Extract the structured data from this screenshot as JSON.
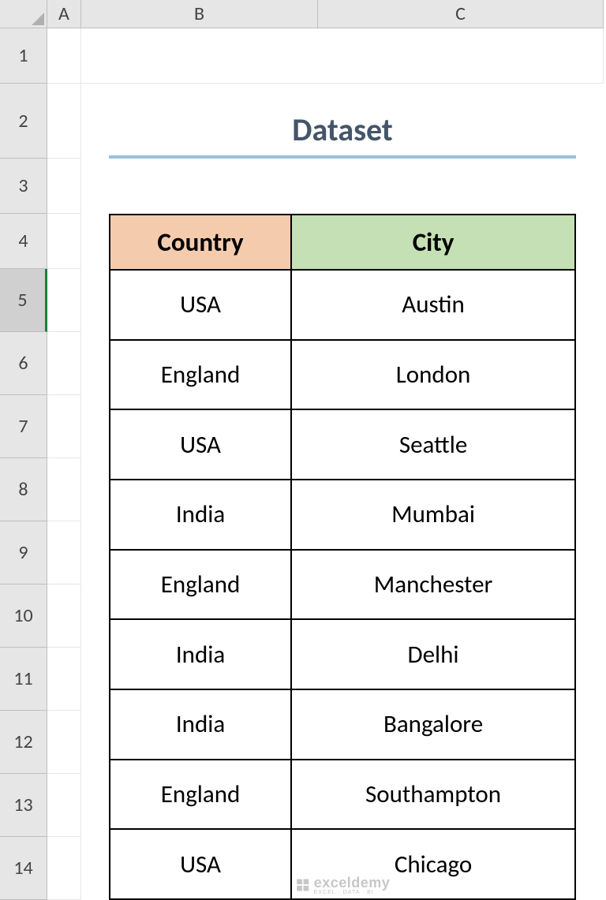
{
  "columns": [
    "A",
    "B",
    "C"
  ],
  "rows": [
    "1",
    "2",
    "3",
    "4",
    "5",
    "6",
    "7",
    "8",
    "9",
    "10",
    "11",
    "12",
    "13",
    "14"
  ],
  "selected_row": "5",
  "title": "Dataset",
  "table": {
    "headers": {
      "country": "Country",
      "city": "City"
    },
    "rows": [
      {
        "country": "USA",
        "city": "Austin"
      },
      {
        "country": "England",
        "city": "London"
      },
      {
        "country": "USA",
        "city": "Seattle"
      },
      {
        "country": "India",
        "city": "Mumbai"
      },
      {
        "country": "England",
        "city": "Manchester"
      },
      {
        "country": "India",
        "city": "Delhi"
      },
      {
        "country": "India",
        "city": "Bangalore"
      },
      {
        "country": "England",
        "city": "Southampton"
      },
      {
        "country": "USA",
        "city": "Chicago"
      }
    ]
  },
  "watermark": {
    "brand": "exceldemy",
    "tagline": "EXCEL · DATA · BI"
  }
}
